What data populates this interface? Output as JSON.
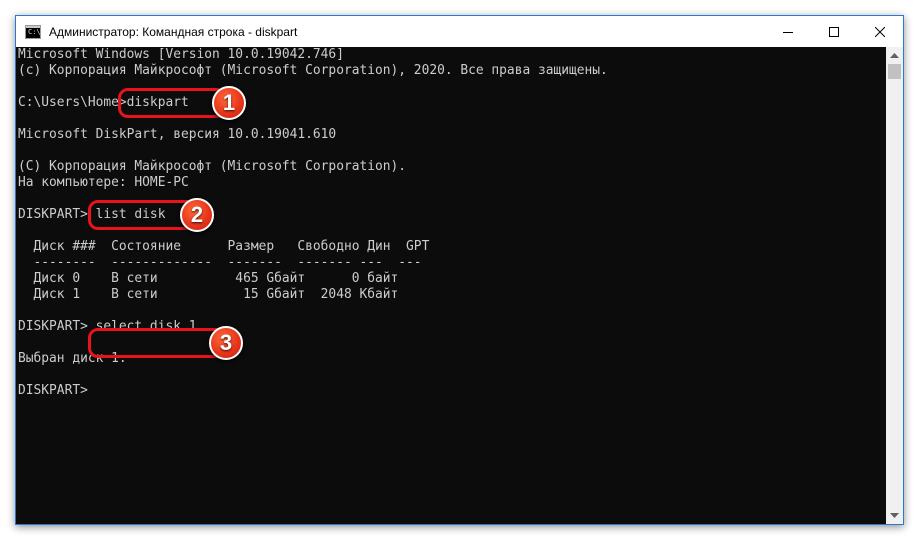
{
  "window": {
    "title": "Администратор: Командная строка - diskpart",
    "icon": "cmd-icon",
    "controls": [
      "minimize-icon",
      "maximize-icon",
      "close-icon"
    ]
  },
  "console": {
    "lines": [
      "Microsoft Windows [Version 10.0.19042.746]",
      "(c) Корпорация Майкрософт (Microsoft Corporation), 2020. Все права защищены.",
      "",
      "C:\\Users\\Home>diskpart",
      "",
      "Microsoft DiskPart, версия 10.0.19041.610",
      "",
      "(C) Корпорация Майкрософт (Microsoft Corporation).",
      "На компьютере: HOME-PC",
      "",
      "DISKPART> list disk",
      "",
      "  Диск ###  Состояние      Размер   Свободно Дин  GPT",
      "  --------  -------------  -------  ------- ---  ---",
      "  Диск 0    В сети          465 Gбайт      0 байт",
      "  Диск 1    В сети           15 Gбайт  2048 Kбайт",
      "",
      "DISKPART> select disk 1",
      "",
      "Выбран диск 1.",
      "",
      "DISKPART>"
    ]
  },
  "annotations": {
    "steps": [
      "1",
      "2",
      "3"
    ],
    "highlight_color": "#e8141c"
  },
  "colors": {
    "console_bg": "#0c0c0c",
    "console_text": "#cccccc",
    "window_border": "#2b78d4"
  }
}
